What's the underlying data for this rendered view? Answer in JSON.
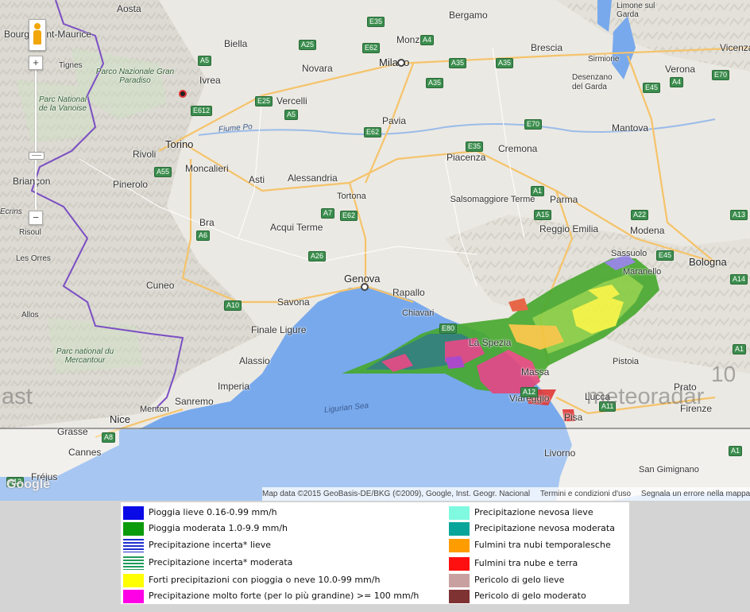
{
  "map": {
    "places": [
      {
        "name": "Aosta"
      },
      {
        "name": "Bourg-Saint-Maurice"
      },
      {
        "name": "Tignes"
      },
      {
        "name": "Biella"
      },
      {
        "name": "Ivrea"
      },
      {
        "name": "Novara"
      },
      {
        "name": "Monza"
      },
      {
        "name": "Milano"
      },
      {
        "name": "Bergamo"
      },
      {
        "name": "Brescia"
      },
      {
        "name": "Verona"
      },
      {
        "name": "Vicenza"
      },
      {
        "name": "Sirmione"
      },
      {
        "name": "Desenzano del Garda"
      },
      {
        "name": "Limone sul Garda"
      },
      {
        "name": "Vercelli"
      },
      {
        "name": "Pavia"
      },
      {
        "name": "Torino"
      },
      {
        "name": "Rivoli"
      },
      {
        "name": "Moncalieri"
      },
      {
        "name": "Cremona"
      },
      {
        "name": "Mantova"
      },
      {
        "name": "Briançon"
      },
      {
        "name": "Pinerolo"
      },
      {
        "name": "Asti"
      },
      {
        "name": "Alessandria"
      },
      {
        "name": "Tortona"
      },
      {
        "name": "Piacenza"
      },
      {
        "name": "Salsomaggiore Terme"
      },
      {
        "name": "Parma"
      },
      {
        "name": "Reggio Emilia"
      },
      {
        "name": "Modena"
      },
      {
        "name": "Bra"
      },
      {
        "name": "Acqui Terme"
      },
      {
        "name": "Risoul"
      },
      {
        "name": "Les Orres"
      },
      {
        "name": "Cuneo"
      },
      {
        "name": "Genova"
      },
      {
        "name": "Rapallo"
      },
      {
        "name": "Chiavari"
      },
      {
        "name": "Savona"
      },
      {
        "name": "Sassuolo"
      },
      {
        "name": "Maranello"
      },
      {
        "name": "Bologna"
      },
      {
        "name": "Finale Ligure"
      },
      {
        "name": "La Spezia"
      },
      {
        "name": "Massa"
      },
      {
        "name": "Alassio"
      },
      {
        "name": "Pistoia"
      },
      {
        "name": "Prato"
      },
      {
        "name": "Viareggio"
      },
      {
        "name": "Lucca"
      },
      {
        "name": "Imperia"
      },
      {
        "name": "Sanremo"
      },
      {
        "name": "Menton"
      },
      {
        "name": "Nice"
      },
      {
        "name": "Firenze"
      },
      {
        "name": "Grasse"
      },
      {
        "name": "Pisa"
      },
      {
        "name": "Cannes"
      },
      {
        "name": "Livorno"
      },
      {
        "name": "San Gimignano"
      },
      {
        "name": "Fréjus"
      },
      {
        "name": "Allos"
      },
      {
        "name": "Ecrins"
      }
    ],
    "parks": [
      "Parco Nazionale Gran Paradiso",
      "Parc National de la Vanoise",
      "Parc national du Mercantour"
    ],
    "sea_label": "Ligurian Sea",
    "river_label": "Fiume Po",
    "shields": [
      "E35",
      "A25",
      "A5",
      "E62",
      "A4",
      "A35",
      "A35",
      "A35",
      "E45",
      "A4",
      "E70",
      "E25",
      "E612",
      "A5",
      "E62",
      "E35",
      "E70",
      "A55",
      "A6",
      "A7",
      "E62",
      "A1",
      "A15",
      "A22",
      "A13",
      "E45",
      "A14",
      "A26",
      "A10",
      "E80",
      "A8",
      "A12",
      "A1",
      "A11",
      "A1",
      "A12"
    ],
    "watermark_text": "meteoradar",
    "watermark_num": "10",
    "watermark_left": "ast",
    "google_logo": "Google",
    "attribution": "Map data ©2015 GeoBasis-DE/BKG (©2009), Google, Inst. Geogr. Nacional",
    "terms": "Termini e condizioni d'uso",
    "report": "Segnala un errore nella mappa",
    "zoom_in": "+",
    "zoom_out": "−"
  },
  "legend": {
    "left": [
      {
        "label": "Pioggia lieve 0.16-0.99 mm/h",
        "color": "#0a0ae6"
      },
      {
        "label": "Pioggia moderata 1.0-9.9 mm/h",
        "color": "#0c9b0c"
      },
      {
        "label": "Precipitazione incerta* lieve",
        "color": "#1e2ed0",
        "striped": true
      },
      {
        "label": "Precipitazione incerta* moderata",
        "color": "#1f9a5a",
        "striped": true
      },
      {
        "label": "Forti precipitazioni con pioggia o neve 10.0-99 mm/h",
        "color": "#ffff00"
      },
      {
        "label": "Precipitazione molto forte (per lo più grandine) >= 100 mm/h",
        "color": "#ff00e6"
      }
    ],
    "right": [
      {
        "label": "Precipitazione nevosa lieve",
        "color": "#7ffae0"
      },
      {
        "label": "Precipitazione nevosa moderata",
        "color": "#0aa59a"
      },
      {
        "label": "Fulmini tra nubi temporalesche",
        "color": "#ff9c00"
      },
      {
        "label": "Fulmini tra nube e terra",
        "color": "#ff1010"
      },
      {
        "label": "Pericolo di gelo lieve",
        "color": "#c9a0a0"
      },
      {
        "label": "Pericolo di gelo moderato",
        "color": "#7e3232"
      }
    ]
  }
}
